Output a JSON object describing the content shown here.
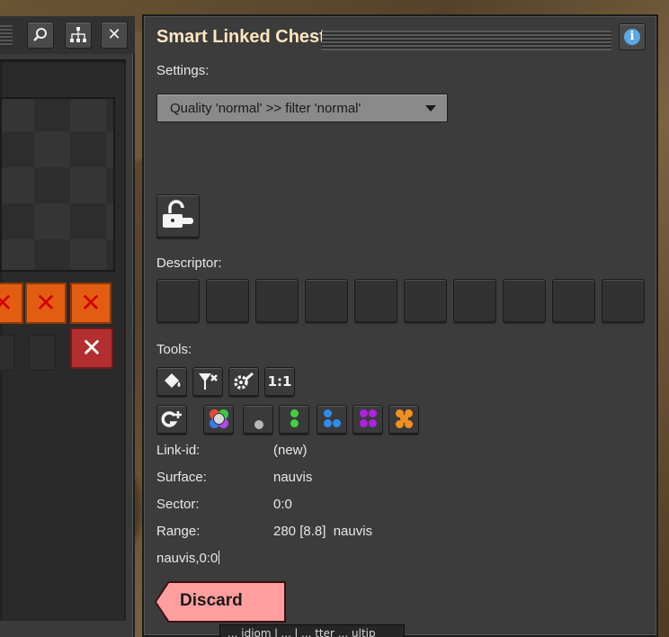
{
  "left_panel": {
    "search_icon": "⌕",
    "network_icon": "hierarchy-icon",
    "close_icon": "✕",
    "red_marks": [
      "✕",
      "✕",
      "✕"
    ],
    "remove_icon": "✕"
  },
  "window": {
    "title": "Smart Linked Chest",
    "info_icon": "i"
  },
  "settings": {
    "label": "Settings:",
    "dropdown_value": "Quality 'normal' >> filter 'normal'"
  },
  "descriptor": {
    "label": "Descriptor:",
    "slot_count": 10
  },
  "tools": {
    "label": "Tools:",
    "row1": [
      {
        "name": "paint-bucket-icon",
        "glyph": "⛾"
      },
      {
        "name": "filter-clear-icon",
        "glyph": "⚲"
      },
      {
        "name": "wrench-gear-icon",
        "glyph": "⚙"
      },
      {
        "name": "one-to-one-icon",
        "glyph": "1:1"
      }
    ],
    "row2": [
      {
        "name": "add-signal-icon",
        "glyph": "G+"
      },
      {
        "name": "multicolor-dots-icon"
      },
      {
        "name": "gray-dot-icon"
      },
      {
        "name": "green-dots-icon"
      },
      {
        "name": "blue-dots-icon"
      },
      {
        "name": "purple-dots-icon"
      },
      {
        "name": "orange-dots-icon"
      }
    ]
  },
  "info": {
    "link_id_label": "Link-id:",
    "link_id_value": "(new)",
    "surface_label": "Surface:",
    "surface_value": "nauvis",
    "sector_label": "Sector:",
    "sector_value": "0:0",
    "range_label": "Range:",
    "range_value": "280 [8.8]  nauvis",
    "text_input_value": "nauvis,0:0"
  },
  "buttons": {
    "discard_label": "Discard"
  },
  "tooltip": {
    "text": "... idiom l ... l ... tter ... ultip"
  },
  "colors": {
    "title": "#ffe6c0",
    "discard": "#ff9e9e",
    "dropdown": "#8a8a8a",
    "info": "#5aa8e6"
  }
}
